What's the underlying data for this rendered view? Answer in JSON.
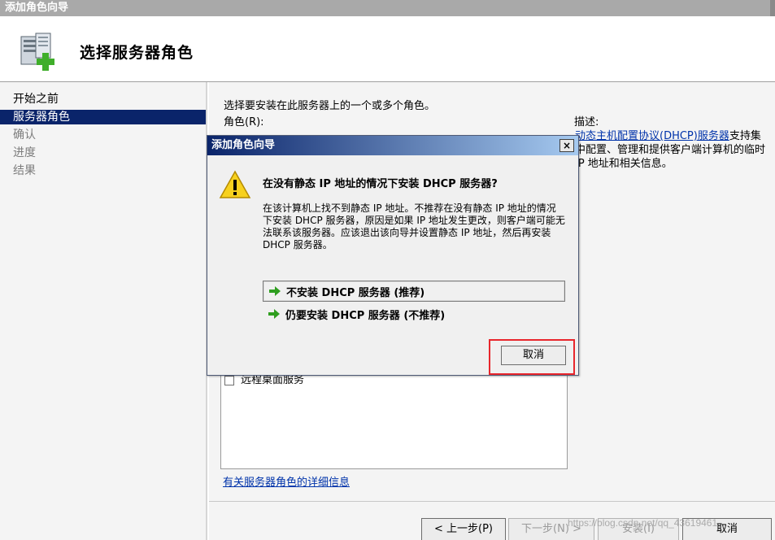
{
  "window": {
    "title": "添加角色向导"
  },
  "header": {
    "title": "选择服务器角色",
    "icon": "server-add-icon"
  },
  "sidebar": {
    "steps": [
      {
        "label": "开始之前",
        "state": "normal"
      },
      {
        "label": "服务器角色",
        "state": "active"
      },
      {
        "label": "确认",
        "state": "disabled"
      },
      {
        "label": "进度",
        "state": "disabled"
      },
      {
        "label": "结果",
        "state": "disabled"
      }
    ]
  },
  "main": {
    "intro": "选择要安装在此服务器上的一个或多个角色。",
    "roles_label": "角色(R):",
    "visible_role": "远程桌面服务",
    "more_info_link": "有关服务器角色的详细信息",
    "description_label": "描述:",
    "description_link": "动态主机配置协议(DHCP)服务器",
    "description_text": "支持集中配置、管理和提供客户端计算机的临时 IP 地址和相关信息。"
  },
  "wizard_buttons": {
    "back": "< 上一步(P)",
    "next": "下一步(N) >",
    "install": "安装(I)",
    "cancel": "取消"
  },
  "dialog": {
    "title": "添加角色向导",
    "close": "×",
    "heading": "在没有静态 IP 地址的情况下安装 DHCP 服务器?",
    "body": "在该计算机上找不到静态 IP 地址。不推荐在没有静态 IP 地址的情况下安装 DHCP 服务器，原因是如果 IP 地址发生更改，则客户端可能无法联系该服务器。应该退出该向导并设置静态 IP 地址，然后再安装 DHCP 服务器。",
    "option_no_install": "不安装 DHCP 服务器 (推荐)",
    "option_install_anyway": "仍要安装 DHCP 服务器 (不推荐)",
    "cancel": "取消"
  },
  "watermark": "https://blog.csdn.net/qq_43619461",
  "colors": {
    "accent": "#0a246a",
    "link": "#0033aa",
    "highlight_box": "#e8262c"
  }
}
